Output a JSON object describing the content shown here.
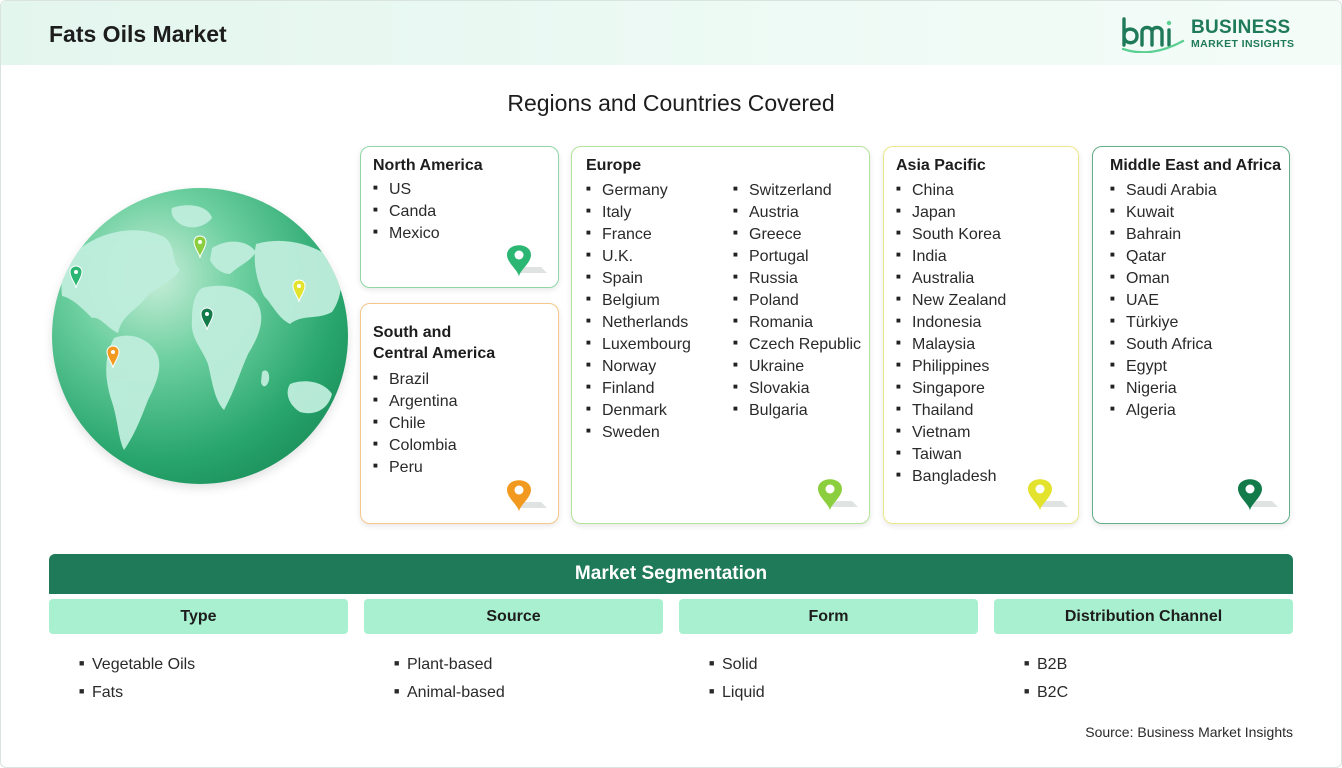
{
  "header": {
    "title": "Fats Oils Market",
    "logo_line1": "BUSINESS",
    "logo_line2": "MARKET INSIGHTS",
    "logo_mark": "bmi"
  },
  "regions_title": "Regions and Countries Covered",
  "regions": {
    "north_america": {
      "title": "North America",
      "pin_color": "#2bb673",
      "countries": [
        "US",
        "Canda",
        "Mexico"
      ]
    },
    "south_central_america": {
      "title_line1": "South and",
      "title_line2": "Central America",
      "pin_color": "#f29a1f",
      "countries": [
        "Brazil",
        "Argentina",
        "Chile",
        "Colombia",
        "Peru"
      ]
    },
    "europe": {
      "title": "Europe",
      "pin_color": "#8ccf3e",
      "countries_col1": [
        "Germany",
        "Italy",
        "France",
        "U.K.",
        "Spain",
        "Belgium",
        "Netherlands",
        "Luxembourg",
        "Norway",
        "Finland",
        "Denmark",
        "Sweden"
      ],
      "countries_col2": [
        "Switzerland",
        "Austria",
        "Greece",
        "Portugal",
        "Russia",
        "Poland",
        "Romania",
        "Czech Republic",
        "Ukraine",
        "Slovakia",
        "Bulgaria"
      ]
    },
    "asia_pacific": {
      "title": "Asia Pacific",
      "pin_color": "#e3e22c",
      "countries": [
        "China",
        "Japan",
        "South Korea",
        "India",
        "Australia",
        "New Zealand",
        "Indonesia",
        "Malaysia",
        "Philippines",
        "Singapore",
        "Thailand",
        "Vietnam",
        "Taiwan",
        "Bangladesh"
      ]
    },
    "middle_east_africa": {
      "title": "Middle East and Africa",
      "pin_color": "#137a4a",
      "countries": [
        "Saudi Arabia",
        "Kuwait",
        "Bahrain",
        "Qatar",
        "Oman",
        "UAE",
        "Türkiye",
        "South Africa",
        "Egypt",
        "Nigeria",
        "Algeria"
      ]
    }
  },
  "segmentation": {
    "title": "Market Segmentation",
    "columns": [
      {
        "header": "Type",
        "items": [
          "Vegetable Oils",
          "Fats"
        ]
      },
      {
        "header": "Source",
        "items": [
          "Plant-based",
          "Animal-based"
        ]
      },
      {
        "header": "Form",
        "items": [
          "Solid",
          "Liquid"
        ]
      },
      {
        "header": "Distribution Channel",
        "items": [
          "B2B",
          "B2C"
        ]
      }
    ]
  },
  "source_text": "Source: Business Market Insights",
  "colors": {
    "brand_green": "#1f7a5a",
    "segment_header": "#a8f0cf",
    "header_bg": "#e3f6ee"
  }
}
